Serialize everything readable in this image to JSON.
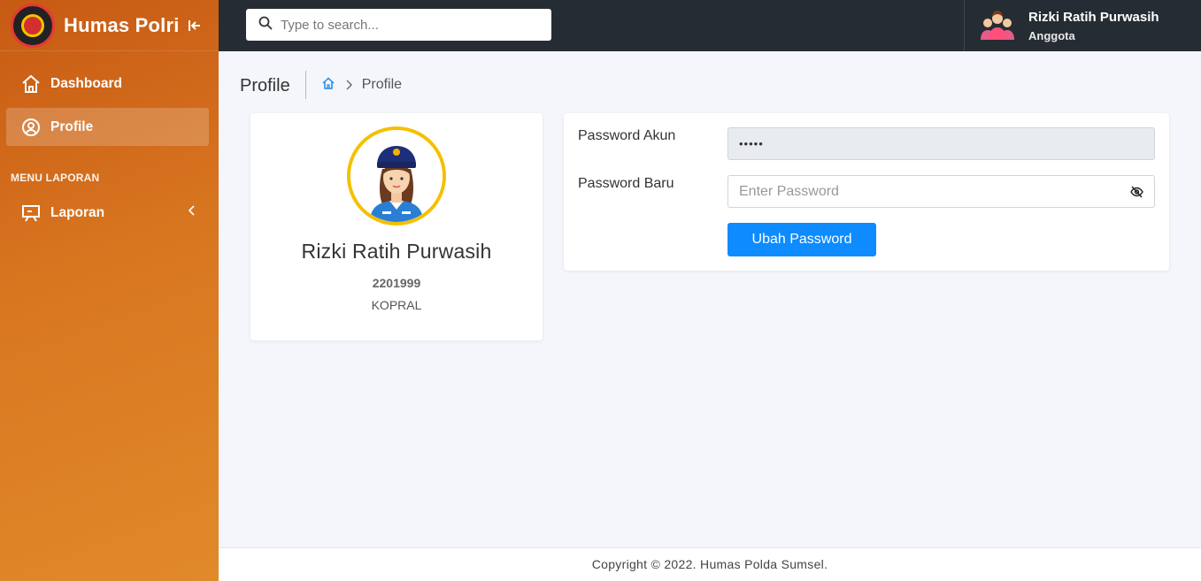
{
  "brand": {
    "title": "Humas Polri"
  },
  "sidebar": {
    "items": [
      {
        "label": "Dashboard",
        "icon": "home-icon"
      },
      {
        "label": "Profile",
        "icon": "user-circle-icon",
        "active": true
      }
    ],
    "section_header": "MENU LAPORAN",
    "report": {
      "label": "Laporan",
      "icon": "presentation-icon"
    }
  },
  "topbar": {
    "search_placeholder": "Type to search...",
    "user": {
      "name": "Rizki Ratih Purwasih",
      "role": "Anggota"
    }
  },
  "page": {
    "title": "Profile",
    "breadcrumb": [
      "home-icon",
      "Profile"
    ]
  },
  "profile": {
    "name": "Rizki Ratih Purwasih",
    "nrp": "2201999",
    "rank": "KOPRAL"
  },
  "password_form": {
    "current_label": "Password Akun",
    "current_value": "•••••",
    "new_label": "Password Baru",
    "new_placeholder": "Enter Password",
    "submit_label": "Ubah Password"
  },
  "footer": {
    "text": "Copyright © 2022. Humas Polda Sumsel."
  },
  "colors": {
    "sidebar": "#d87620",
    "topbar": "#262c33",
    "primary": "#0d8bff"
  }
}
